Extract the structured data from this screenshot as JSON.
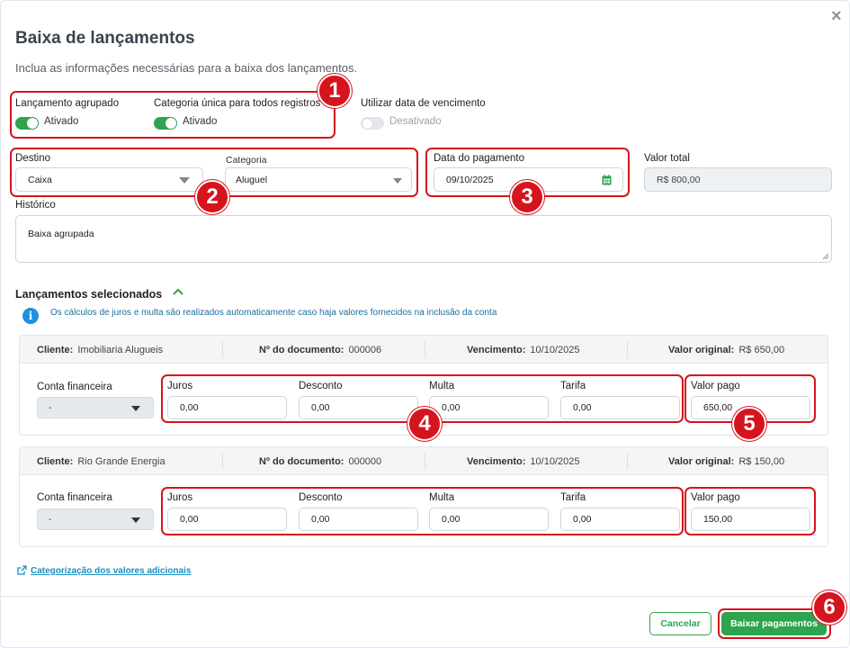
{
  "modal": {
    "title": "Baixa de lançamentos",
    "subtitle": "Inclua as informações necessárias para a baixa dos lançamentos.",
    "close_label": "×"
  },
  "toggles": [
    {
      "label": "Lançamento agrupado",
      "state_text": "Ativado",
      "on": true
    },
    {
      "label": "Categoria única para todos registros",
      "state_text": "Ativado",
      "on": true
    },
    {
      "label": "Utilizar data de vencimento",
      "state_text": "Desativado",
      "on": false
    }
  ],
  "destino": {
    "label": "Destino",
    "value": "Caixa"
  },
  "categoria": {
    "label": "Categoria",
    "value": "Aluguel"
  },
  "data_pagamento": {
    "label": "Data do pagamento",
    "value": "09/10/2025"
  },
  "valor_total": {
    "label": "Valor total",
    "value": "R$ 800,00"
  },
  "historico": {
    "label": "Histórico",
    "value": "Baixa agrupada"
  },
  "selecionados": {
    "title": "Lançamentos selecionados",
    "info": "Os cálculos de juros e multa são realizados automaticamente caso haja valores fornecidos na inclusão da conta"
  },
  "labels": {
    "cliente": "Cliente:",
    "documento": "Nº do documento:",
    "vencimento": "Vencimento:",
    "valor_original": "Valor original:",
    "conta_financeira": "Conta financeira",
    "juros": "Juros",
    "desconto": "Desconto",
    "multa": "Multa",
    "tarifa": "Tarifa",
    "valor_pago": "Valor pago"
  },
  "lancamentos": [
    {
      "cliente": "Imobiliaria Alugueis",
      "documento": "000006",
      "vencimento": "10/10/2025",
      "valor_original": "R$ 650,00",
      "conta": "-",
      "juros": "0,00",
      "desconto": "0,00",
      "multa": "0,00",
      "tarifa": "0,00",
      "valor_pago": "650,00"
    },
    {
      "cliente": "Rio Grande Energia",
      "documento": "000000",
      "vencimento": "10/10/2025",
      "valor_original": "R$ 150,00",
      "conta": "-",
      "juros": "0,00",
      "desconto": "0,00",
      "multa": "0,00",
      "tarifa": "0,00",
      "valor_pago": "150,00"
    }
  ],
  "link": {
    "label": "Categorização dos valores adicionais"
  },
  "buttons": {
    "cancel": "Cancelar",
    "submit": "Baixar pagamentos"
  },
  "badges": [
    "1",
    "2",
    "3",
    "4",
    "5",
    "6"
  ],
  "colors": {
    "accent": "#2ea44f",
    "highlight": "#d6141e",
    "info": "#1f8fe0"
  }
}
